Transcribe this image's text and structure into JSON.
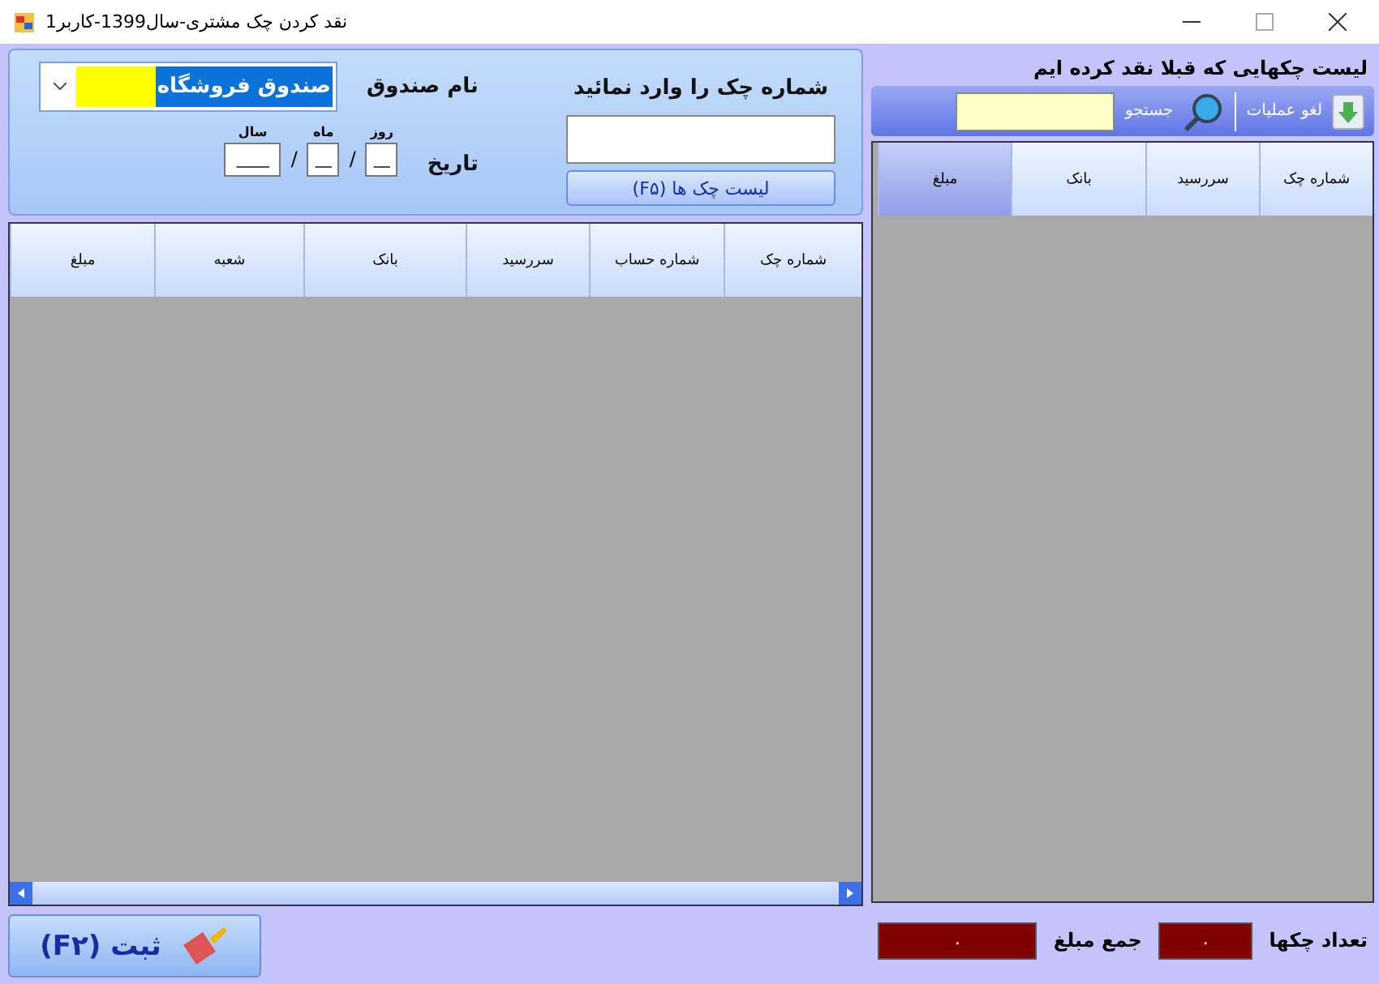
{
  "window": {
    "title": "نقد کردن چک مشتری-سال1399-کاربر1"
  },
  "fund": {
    "label": "نام صندوق",
    "value": "صندوق فروشگاه"
  },
  "date": {
    "label": "تاریخ",
    "parts": [
      {
        "label": "روز",
        "value": "__",
        "kind": "short"
      },
      {
        "label": "ماه",
        "value": "__",
        "kind": "short"
      },
      {
        "label": "سال",
        "value": "____",
        "kind": "long"
      }
    ],
    "separator": "/"
  },
  "check_entry": {
    "label": "شماره چک را وارد نمائید",
    "button": "لیست چک ها  (F۵)"
  },
  "table": {
    "columns": [
      "شماره چک",
      "شماره حساب",
      "سررسید",
      "بانک",
      "شعبه",
      "مبلغ"
    ]
  },
  "save_button": "ثبت  (F۲)",
  "history": {
    "title": "لیست چکهایی که قبلا نقد کرده ایم",
    "cancel": "لغو عملیات",
    "search_label": "جستجو",
    "columns": [
      {
        "label": "شماره چک",
        "selected": false
      },
      {
        "label": "سررسید",
        "selected": false
      },
      {
        "label": "بانک",
        "selected": false
      },
      {
        "label": "مبلغ",
        "selected": true
      }
    ]
  },
  "totals": [
    {
      "label": "تعداد چکها",
      "value": "۰",
      "kind": "short"
    },
    {
      "label": "جمع مبلغ",
      "value": "۰",
      "kind": "long"
    }
  ]
}
